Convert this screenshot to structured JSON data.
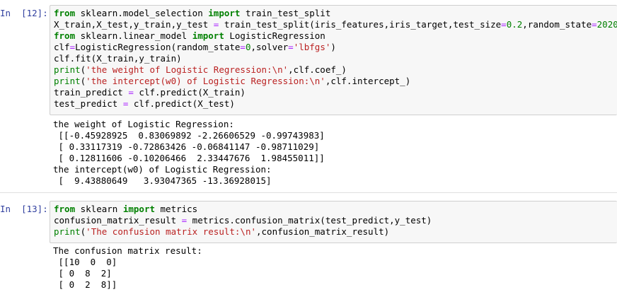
{
  "cells": [
    {
      "prompt": "In  [12]:",
      "code": [
        [
          {
            "t": "from",
            "c": "kw"
          },
          {
            "t": " sklearn.model_selection "
          },
          {
            "t": "import",
            "c": "kw"
          },
          {
            "t": " train_test_split"
          }
        ],
        [
          {
            "t": "X_train,X_test,y_train,y_test "
          },
          {
            "t": "=",
            "c": "op"
          },
          {
            "t": " train_test_split(iris_features,iris_target,test_size"
          },
          {
            "t": "=",
            "c": "op"
          },
          {
            "t": "0.2",
            "c": "num"
          },
          {
            "t": ",random_state"
          },
          {
            "t": "=",
            "c": "op"
          },
          {
            "t": "2020",
            "c": "num"
          },
          {
            "t": ")"
          }
        ],
        [
          {
            "t": "from",
            "c": "kw"
          },
          {
            "t": " sklearn.linear_model "
          },
          {
            "t": "import",
            "c": "kw"
          },
          {
            "t": " LogisticRegression"
          }
        ],
        [
          {
            "t": "clf"
          },
          {
            "t": "=",
            "c": "op"
          },
          {
            "t": "LogisticRegression(random_state"
          },
          {
            "t": "=",
            "c": "op"
          },
          {
            "t": "0",
            "c": "num"
          },
          {
            "t": ",solver"
          },
          {
            "t": "=",
            "c": "op"
          },
          {
            "t": "'lbfgs'",
            "c": "str"
          },
          {
            "t": ")"
          }
        ],
        [
          {
            "t": "clf.fit(X_train,y_train)"
          }
        ],
        [
          {
            "t": "print",
            "c": "bi"
          },
          {
            "t": "("
          },
          {
            "t": "'the weight of Logistic Regression:\\n'",
            "c": "str"
          },
          {
            "t": ",clf.coef_)"
          }
        ],
        [
          {
            "t": "print",
            "c": "bi"
          },
          {
            "t": "("
          },
          {
            "t": "'the intercept(w0) of Logistic Regression:\\n'",
            "c": "str"
          },
          {
            "t": ",clf.intercept_)"
          }
        ],
        [
          {
            "t": "train_predict "
          },
          {
            "t": "=",
            "c": "op"
          },
          {
            "t": " clf.predict(X_train)"
          }
        ],
        [
          {
            "t": "test_predict "
          },
          {
            "t": "=",
            "c": "op"
          },
          {
            "t": " clf.predict(X_test)"
          }
        ]
      ],
      "output": [
        "the weight of Logistic Regression:",
        " [[-0.45928925  0.83069892 -2.26606529 -0.99743983]",
        " [ 0.33117319 -0.72863426 -0.06841147 -0.98711029]",
        " [ 0.12811606 -0.10206466  2.33447676  1.98455011]]",
        "the intercept(w0) of Logistic Regression:",
        " [  9.43880649   3.93047365 -13.36928015]"
      ]
    },
    {
      "prompt": "In  [13]:",
      "code": [
        [
          {
            "t": "from",
            "c": "kw"
          },
          {
            "t": " sklearn "
          },
          {
            "t": "import",
            "c": "kw"
          },
          {
            "t": " metrics"
          }
        ],
        [
          {
            "t": "confusion_matrix_result "
          },
          {
            "t": "=",
            "c": "op"
          },
          {
            "t": " metrics.confusion_matrix(test_predict,y_test)"
          }
        ],
        [
          {
            "t": "print",
            "c": "bi"
          },
          {
            "t": "("
          },
          {
            "t": "'The confusion matrix result:\\n'",
            "c": "str"
          },
          {
            "t": ",confusion_matrix_result)"
          }
        ]
      ],
      "output": [
        "The confusion matrix result:",
        " [[10  0  0]",
        " [ 0  8  2]",
        " [ 0  2  8]]"
      ]
    }
  ]
}
